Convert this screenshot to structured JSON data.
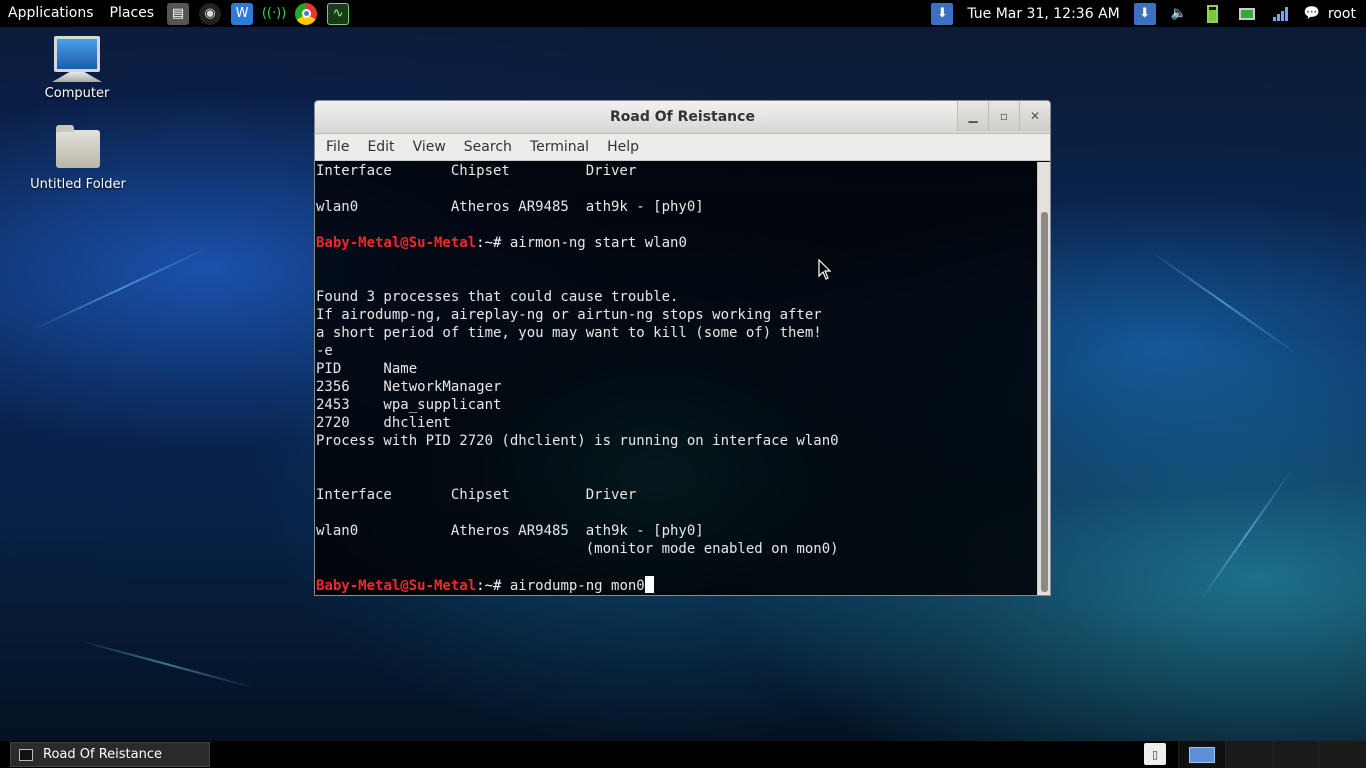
{
  "top_panel": {
    "applications_label": "Applications",
    "places_label": "Places",
    "clock": "Tue Mar 31, 12:36 AM",
    "user": "root"
  },
  "desktop": {
    "icons": [
      {
        "label": "Computer",
        "icon": "computer-icon"
      },
      {
        "label": "Untitled Folder",
        "icon": "folder-icon"
      }
    ]
  },
  "window": {
    "title": "Road Of Reistance",
    "menu": [
      "File",
      "Edit",
      "View",
      "Search",
      "Terminal",
      "Help"
    ]
  },
  "terminal": {
    "lines": [
      "Interface       Chipset         Driver",
      "",
      "wlan0           Atheros AR9485  ath9k - [phy0]",
      "",
      {
        "user": "Baby-Metal@Su-Metal",
        "path": ":~# ",
        "cmd": "airmon-ng start wlan0"
      },
      "",
      "",
      "Found 3 processes that could cause trouble.",
      "If airodump-ng, aireplay-ng or airtun-ng stops working after",
      "a short period of time, you may want to kill (some of) them!",
      "-e",
      "PID     Name",
      "2356    NetworkManager",
      "2453    wpa_supplicant",
      "2720    dhclient",
      "Process with PID 2720 (dhclient) is running on interface wlan0",
      "",
      "",
      "Interface       Chipset         Driver",
      "",
      "wlan0           Atheros AR9485  ath9k - [phy0]",
      "                                (monitor mode enabled on mon0)",
      "",
      {
        "user": "Baby-Metal@Su-Metal",
        "path": ":~# ",
        "cmd": "airodump-ng mon0",
        "cursor": true
      }
    ]
  },
  "taskbar": {
    "task_label": "Road Of Reistance"
  },
  "colors": {
    "prompt_user": "#ef2929",
    "panel_bg": "#000000"
  }
}
